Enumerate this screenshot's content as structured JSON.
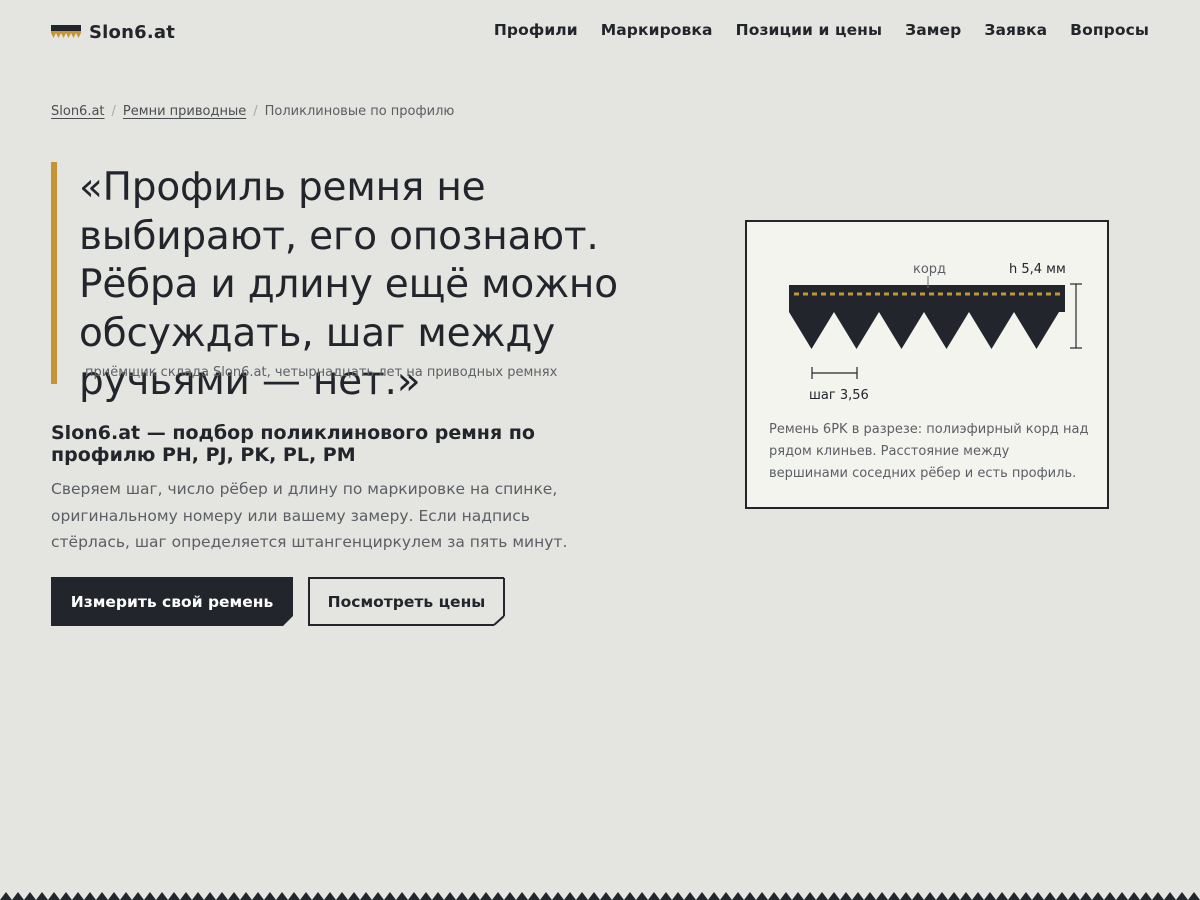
{
  "site": {
    "logo_text": "Slon6.at",
    "nav": [
      "Профили",
      "Маркировка",
      "Позиции и цены",
      "Замер",
      "Заявка",
      "Вопросы"
    ]
  },
  "breadcrumb": {
    "items": [
      "Slon6.at",
      "Ремни приводные"
    ],
    "current": "Поликлиновые по профилю",
    "separator": "/"
  },
  "quote": {
    "text": "«Профиль ремня не выбирают, его опознают. Рёбра и длину ещё можно обсуждать, шаг между ручьями — нет.»",
    "caption": "приёмщик склада Slon6.at, четырнадцать лет на приводных ремнях"
  },
  "intro": {
    "title": "Slon6.at — подбор поликлинового ремня по профилю PH, PJ, PK, PL, PM",
    "text": "Сверяем шаг, число рёбер и длину по маркировке на спинке, оригинальному номеру или вашему замеру. Если надпись стёрлась, шаг определяется штангенциркулем за пять минут."
  },
  "buttons": {
    "primary": "Измерить свой ремень",
    "secondary": "Посмотреть цены"
  },
  "diagram": {
    "label_cord": "корд",
    "label_height": "h 5,4 мм",
    "label_pitch": "шаг 3,56",
    "caption": "Ремень 6PK в разрезе: полиэфирный корд над рядом клиньев. Расстояние между вершинами соседних рёбер и есть профиль.",
    "ribs": 6
  },
  "colors": {
    "background": "#e4e5e0",
    "ink": "#22252b",
    "accent": "#c59535",
    "card": "#f4f4ef",
    "muted": "#5b5e64"
  },
  "icons": {
    "logo": "belt-logo-icon"
  }
}
